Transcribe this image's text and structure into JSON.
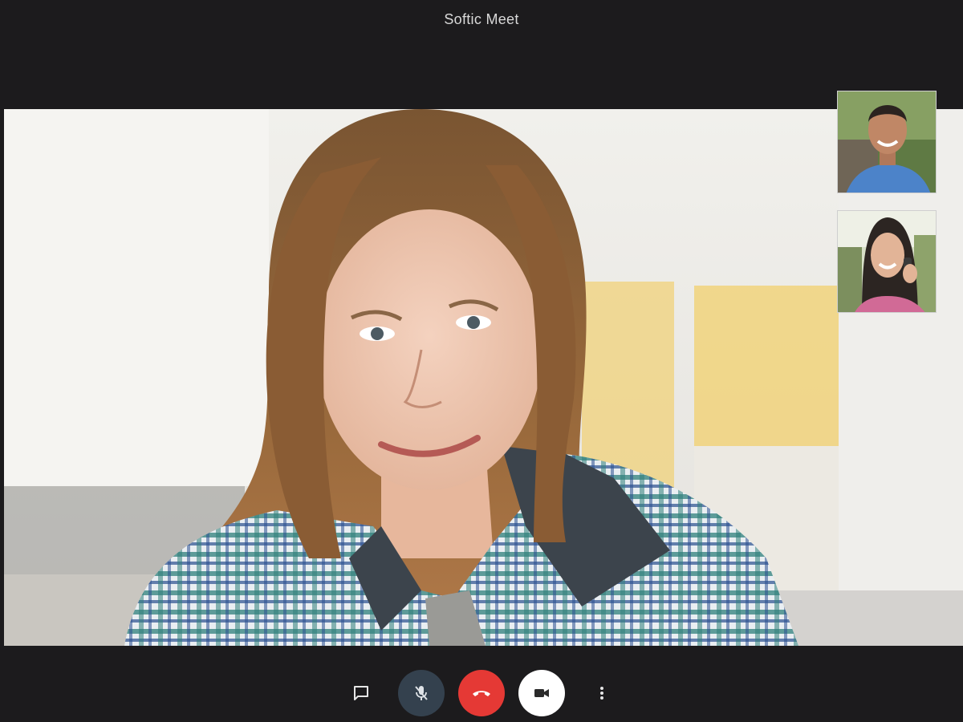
{
  "window": {
    "title": "Softic Meet"
  },
  "participants": {
    "main": {
      "name": "main-participant-video"
    },
    "thumbnails": [
      {
        "name": "participant-thumbnail-man"
      },
      {
        "name": "participant-thumbnail-woman"
      }
    ]
  },
  "controls": {
    "chat": {
      "icon": "chat-icon"
    },
    "mic": {
      "icon": "mic-off-icon",
      "state": "muted",
      "color": "#34414e"
    },
    "hangup": {
      "icon": "hangup-icon",
      "color": "#e53935"
    },
    "camera": {
      "icon": "videocam-icon",
      "color": "#ffffff"
    },
    "more": {
      "icon": "more-vertical-icon"
    }
  }
}
